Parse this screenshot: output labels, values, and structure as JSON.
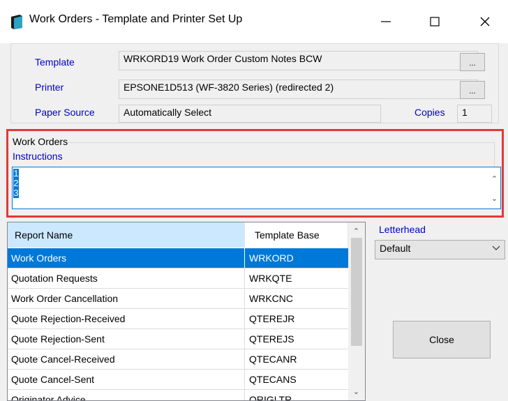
{
  "window": {
    "title": "Work Orders - Template and Printer Set Up",
    "icon": "document-book-icon"
  },
  "setup": {
    "template_label": "Template",
    "template_value": "WRKORD19 Work Order Custom Notes BCW",
    "template_browse": "...",
    "printer_label": "Printer",
    "printer_value": "EPSONE1D513 (WF-3820 Series) (redirected 2)",
    "printer_browse": "...",
    "paper_source_label": "Paper Source",
    "paper_source_value": "Automatically Select",
    "copies_label": "Copies",
    "copies_value": "1"
  },
  "work_orders_group": {
    "title": "Work Orders",
    "instructions_label": "Instructions",
    "instructions_lines": [
      "1",
      "2",
      "3"
    ]
  },
  "reports": {
    "columns": [
      "Report Name",
      "Template Base"
    ],
    "rows": [
      {
        "name": "Work Orders",
        "base": "WRKORD",
        "selected": true
      },
      {
        "name": "Quotation Requests",
        "base": "WRKQTE"
      },
      {
        "name": "Work Order Cancellation",
        "base": "WRKCNC"
      },
      {
        "name": "Quote Rejection-Received",
        "base": "QTEREJR"
      },
      {
        "name": "Quote Rejection-Sent",
        "base": "QTEREJS"
      },
      {
        "name": "Quote Cancel-Received",
        "base": "QTECANR"
      },
      {
        "name": "Quote Cancel-Sent",
        "base": "QTECANS"
      },
      {
        "name": "Originator Advice",
        "base": "ORIGLTR"
      }
    ]
  },
  "letterhead": {
    "label": "Letterhead",
    "selected": "Default"
  },
  "close_button": "Close",
  "colors": {
    "selection": "#0078d7",
    "label_blue": "#0000c8",
    "highlight_frame": "#e03a3a",
    "header_selected": "#cce8ff"
  }
}
